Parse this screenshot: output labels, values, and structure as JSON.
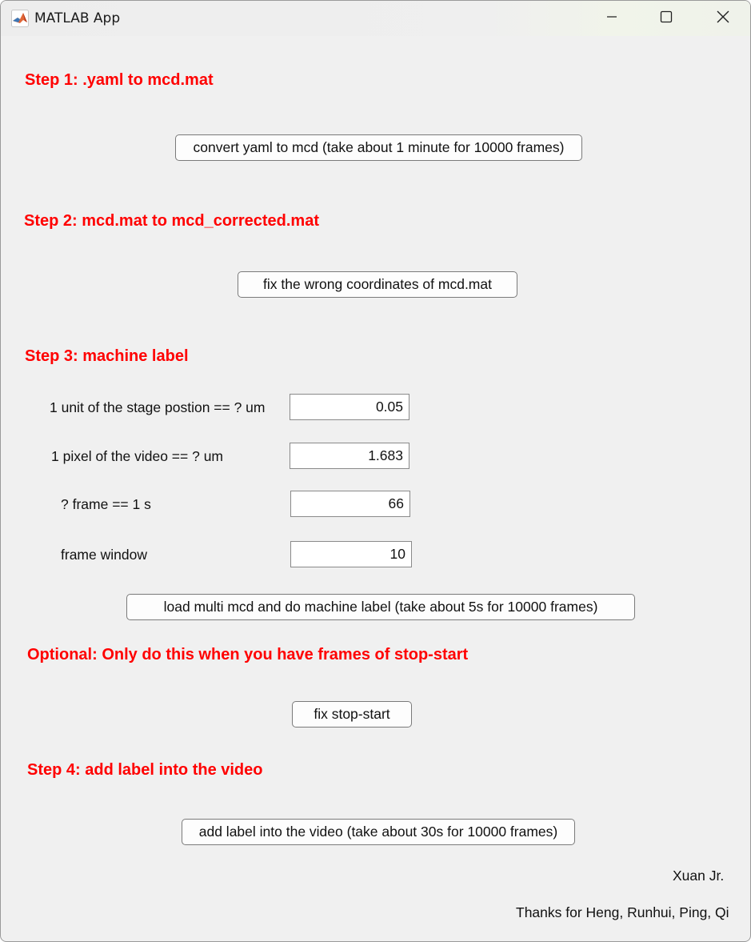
{
  "window": {
    "title": "MATLAB App"
  },
  "step1": {
    "heading": "Step 1: .yaml to mcd.mat",
    "button": "convert yaml to mcd (take about 1 minute for 10000 frames)"
  },
  "step2": {
    "heading": "Step 2: mcd.mat to mcd_corrected.mat",
    "button": "fix the wrong coordinates of mcd.mat"
  },
  "step3": {
    "heading": "Step 3: machine label",
    "fields": [
      {
        "label": "1 unit of the stage postion == ? um",
        "value": "0.05"
      },
      {
        "label": "1 pixel of the video == ? um",
        "value": "1.683"
      },
      {
        "label": "? frame == 1 s",
        "value": "66"
      },
      {
        "label": "frame window",
        "value": "10"
      }
    ],
    "button": "load multi mcd and do machine label (take about 5s for 10000 frames)"
  },
  "optional": {
    "heading": "Optional: Only do this when you have frames of stop-start",
    "button": "fix stop-start"
  },
  "step4": {
    "heading": "Step 4: add label into the video",
    "button": "add label into the video (take about 30s for 10000 frames)"
  },
  "credits": {
    "author": "Xuan Jr.",
    "thanks": "Thanks for Heng, Runhui, Ping, Qi"
  },
  "colors": {
    "heading": "#ff0000",
    "background": "#f0f0f0"
  },
  "icons": [
    "matlab-app-icon",
    "minimize-icon",
    "maximize-icon",
    "close-icon"
  ]
}
